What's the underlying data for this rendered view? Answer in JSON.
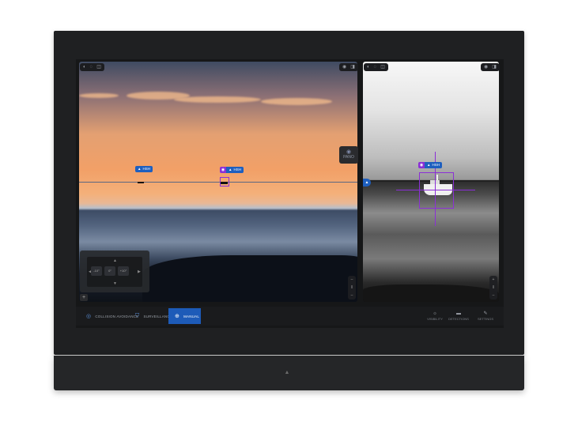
{
  "visible_camera": {
    "tag_left": {
      "icon": "warning-triangle",
      "label": "HSH"
    },
    "tag_right": {
      "icon": "eye",
      "label": "HSH"
    },
    "toolbar_left": [
      "◐",
      "◌",
      "◫"
    ],
    "toolbar_right": [
      "◉",
      "◨"
    ]
  },
  "thermal_camera": {
    "tag": {
      "icon": "eye",
      "label": "HSH"
    },
    "toolbar_left": [
      "◐",
      "◌",
      "◫"
    ],
    "toolbar_right": [
      "◉",
      "◨"
    ],
    "marker": "▲"
  },
  "swap_button": {
    "label": "PANO"
  },
  "ptz": {
    "zoom_out": "-10°",
    "zoom_mid": "0°",
    "zoom_in": "+10°",
    "up": "▲",
    "down": "▼",
    "left": "◀",
    "right": "▶",
    "add": "+"
  },
  "side_controls": {
    "left": [
      "–",
      "‖",
      "–"
    ],
    "right": [
      "+",
      "‖",
      "–"
    ]
  },
  "modes": [
    {
      "label": "COLLISION AVOIDANCE",
      "icon": "◎"
    },
    {
      "label": "SURVEILLANCE",
      "icon": "⛉"
    },
    {
      "label": "MANUAL",
      "icon": "⊕"
    }
  ],
  "actions": [
    {
      "label": "VISIBILITY",
      "icon": "☼"
    },
    {
      "label": "DETECTIONS",
      "icon": "▬"
    },
    {
      "label": "SETTINGS",
      "icon": "✎"
    }
  ],
  "chin_logo": "▲",
  "colors": {
    "accent": "#1d5bb8",
    "target": "#8b2fd6"
  }
}
